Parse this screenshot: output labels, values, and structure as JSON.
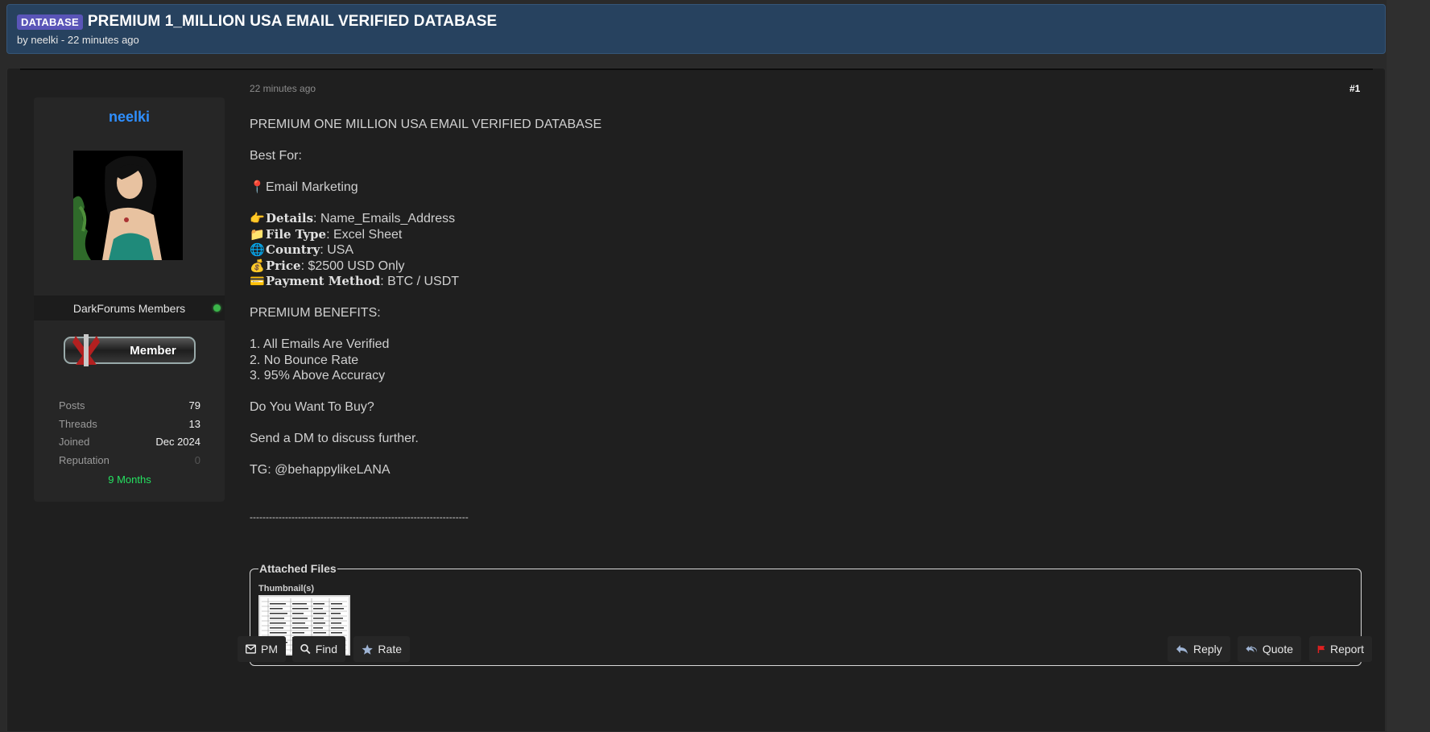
{
  "thread": {
    "prefix": "DATABASE",
    "title": "PREMIUM 1_MILLION USA EMAIL VERIFIED DATABASE",
    "meta": "by neelki - 22 minutes ago"
  },
  "author": {
    "username": "neelki",
    "group": "DarkForums Members",
    "status": "online",
    "rank_badge": "Member",
    "stats": [
      {
        "label": "Posts",
        "value": "79"
      },
      {
        "label": "Threads",
        "value": "13"
      },
      {
        "label": "Joined",
        "value": "Dec 2024"
      },
      {
        "label": "Reputation",
        "value": "0"
      }
    ],
    "tenure": "9 Months"
  },
  "post": {
    "date": "22 minutes ago",
    "number": "#1",
    "headline": "PREMIUM ONE MILLION USA EMAIL VERIFIED DATABASE",
    "best_for": "Best For:",
    "use_case": "Email Marketing",
    "details": [
      {
        "icon": "pointing-hand-icon",
        "glyph": "👉",
        "key": "Details",
        "value": ": Name_Emails_Address"
      },
      {
        "icon": "folder-icon",
        "glyph": "📁",
        "key": "File Type",
        "value": ": Excel Sheet"
      },
      {
        "icon": "globe-icon",
        "glyph": "🌐",
        "key": "Country",
        "value": ": USA"
      },
      {
        "icon": "money-bag-icon",
        "glyph": "💰",
        "key": "Price",
        "value": ": $2500 USD Only"
      },
      {
        "icon": "credit-card-icon",
        "glyph": "💳",
        "key": "Payment Method",
        "value": ": BTC / USDT"
      }
    ],
    "benefits_heading": "PREMIUM BENEFITS:",
    "benefits": [
      "1. All Emails Are Verified",
      "2. No Bounce Rate",
      "3. 95% Above Accuracy"
    ],
    "question": "Do You Want To Buy?",
    "cta": "Send a DM to discuss further.",
    "contact": "TG: @behappylikeLANA",
    "divider": "--------------------------------------------------------------------"
  },
  "attachments": {
    "legend": "Attached Files",
    "thumbs_label": "Thumbnail(s)"
  },
  "actions": {
    "left": [
      {
        "name": "pm-button",
        "label": "PM",
        "icon": "envelope-icon"
      },
      {
        "name": "find-button",
        "label": "Find",
        "icon": "search-icon"
      },
      {
        "name": "rate-button",
        "label": "Rate",
        "icon": "star-icon"
      }
    ],
    "right": [
      {
        "name": "reply-button",
        "label": "Reply",
        "icon": "reply-icon"
      },
      {
        "name": "quote-button",
        "label": "Quote",
        "icon": "quote-icon"
      },
      {
        "name": "report-button",
        "label": "Report",
        "icon": "flag-icon"
      }
    ]
  },
  "colors": {
    "header_bg": "#27425f",
    "username": "#2f8fff",
    "prefix_badge": "#5a55b8",
    "tenure": "#25e060",
    "online": "#3bb54a",
    "report_flag": "#e02020"
  }
}
